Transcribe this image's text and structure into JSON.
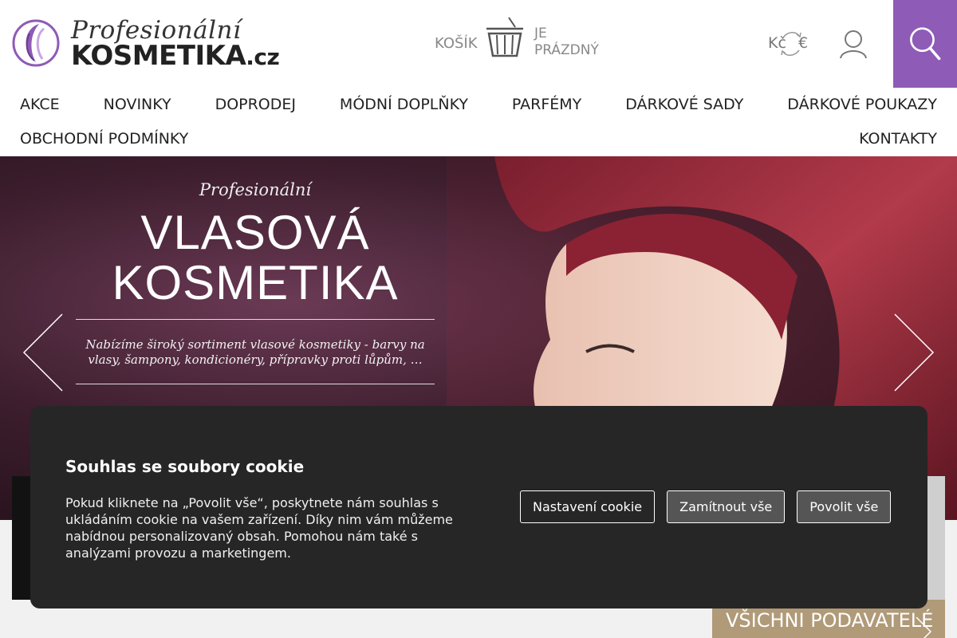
{
  "header": {
    "logo_line1": "Profesionální",
    "logo_line2_main": "KOSMETIKA",
    "logo_line2_tld": ".cz",
    "cart_label": "KOŠÍK",
    "cart_status_line1": "JE",
    "cart_status_line2": "PRÁZDNÝ",
    "currency_primary": "Kč",
    "currency_secondary": "€",
    "accent_color": "#8e5bb6"
  },
  "nav": {
    "row1": [
      "AKCE",
      "NOVINKY",
      "DOPRODEJ",
      "MÓDNÍ DOPLŇKY",
      "PARFÉMY",
      "DÁRKOVÉ SADY",
      "DÁRKOVÉ POUKAZY"
    ],
    "row2": [
      "OBCHODNÍ PODMÍNKY",
      "KONTAKTY"
    ]
  },
  "hero": {
    "kicker": "Profesionální",
    "title_line1": "VLASOVÁ",
    "title_line2": "KOSMETIKA",
    "description": "Nabízíme široký sortiment vlasové kosmetiky - barvy na vlasy, šampony, kondicionéry, přípravky proti lůpům, …"
  },
  "brands_tile": {
    "label": "VŠICHNI PODAVATELÉ"
  },
  "cookie": {
    "title": "Souhlas se soubory cookie",
    "text": "Pokud kliknete na „Povolit vše“, poskytnete nám souhlas s ukládáním cookie na vašem zařízení. Díky nim vám můžeme nabídnou personalizovaný obsah. Pomohou nám také s analýzami provozu a marketingem.",
    "button_settings": "Nastavení cookie",
    "button_reject": "Zamítnout vše",
    "button_accept": "Povolit vše"
  }
}
